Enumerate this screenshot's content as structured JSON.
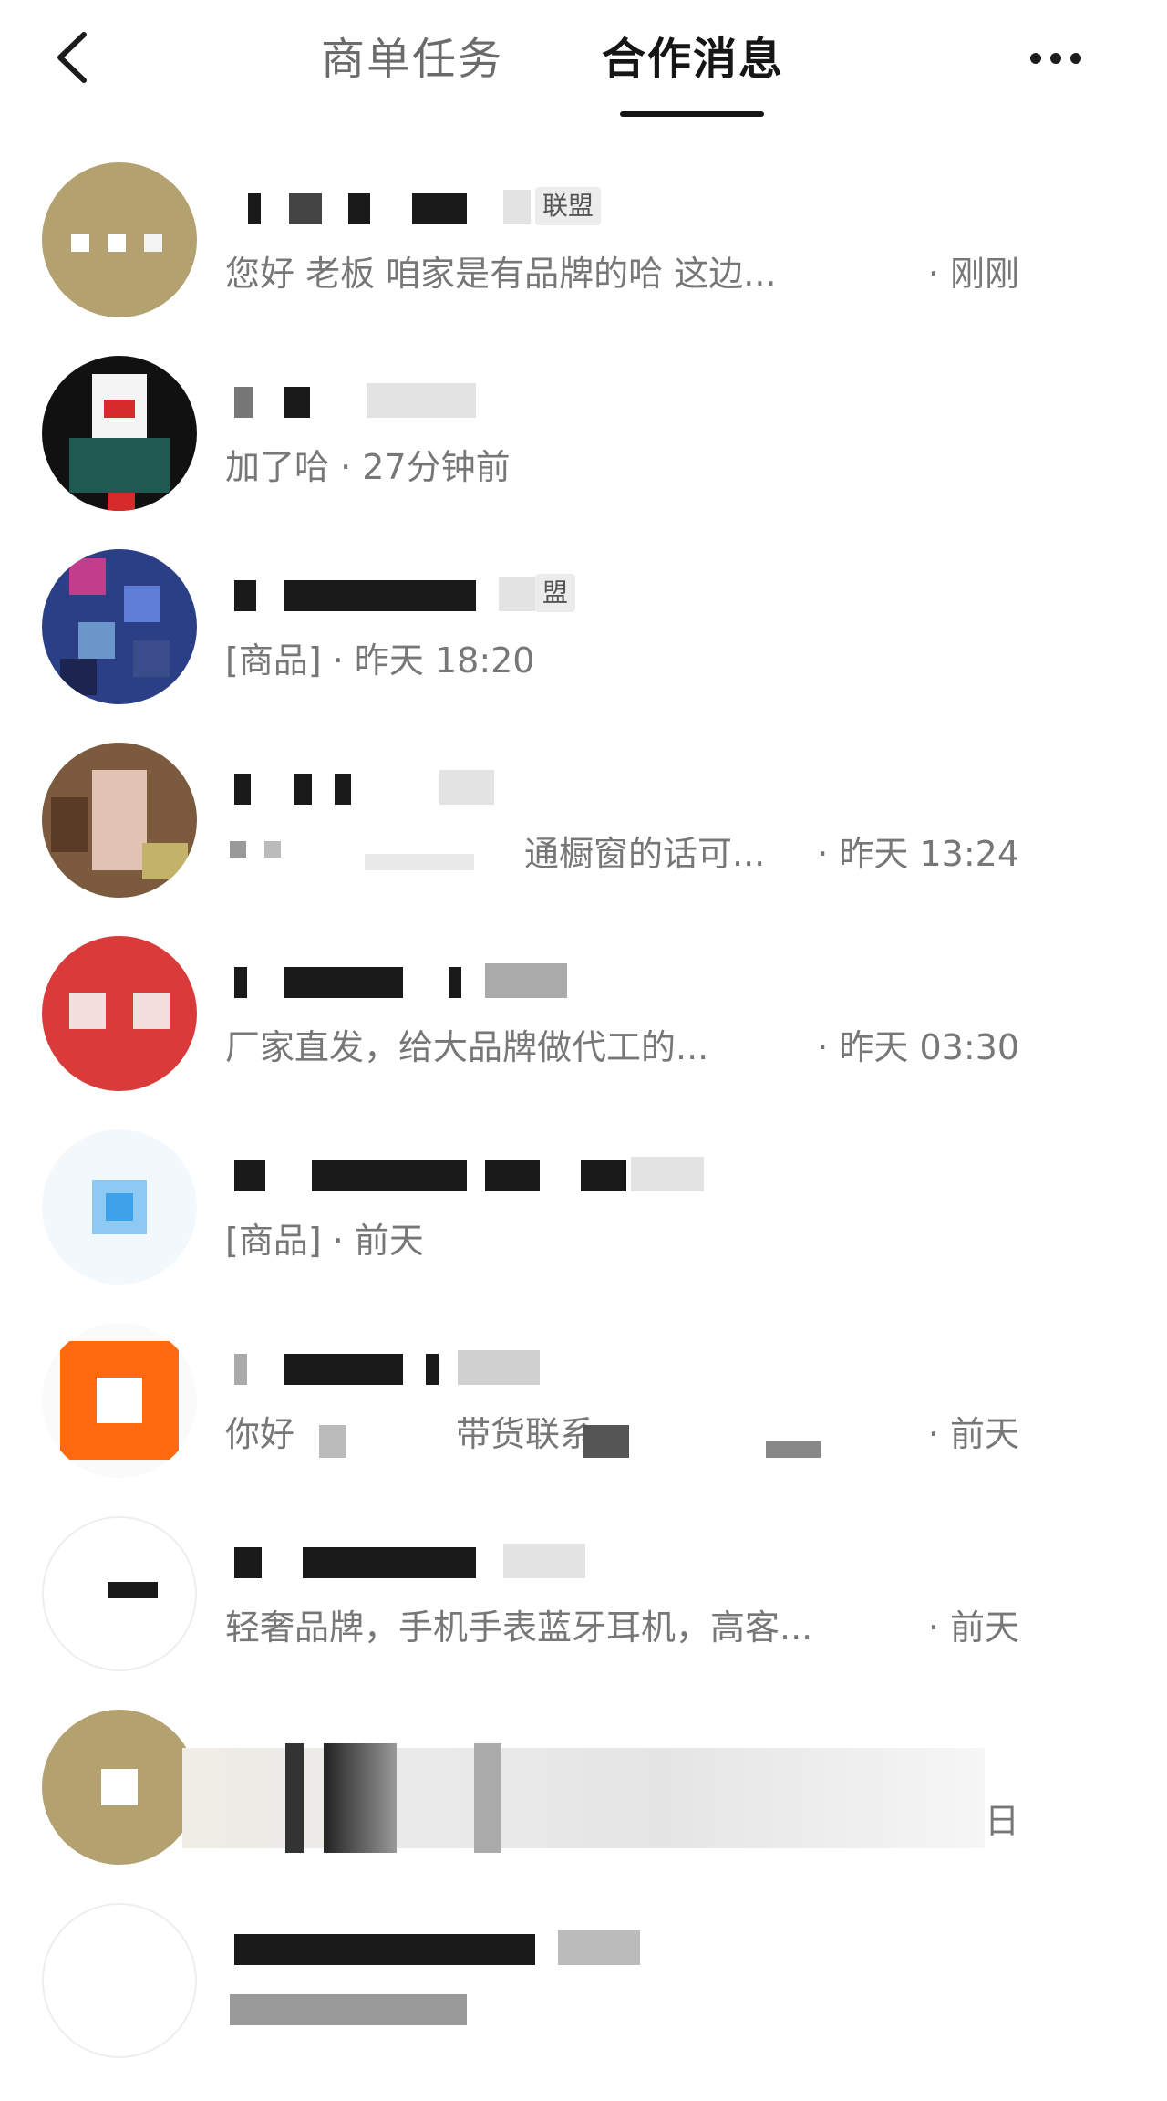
{
  "header": {
    "tabs": [
      {
        "label": "商单任务",
        "active": false
      },
      {
        "label": "合作消息",
        "active": true
      }
    ]
  },
  "messages": [
    {
      "tag": "联盟",
      "preview": "您好 老板  咱家是有品牌的哈   这边...",
      "time": "· 刚刚",
      "avatar_color": "#b3a270"
    },
    {
      "tag": "",
      "preview": "加了哈 · 27分钟前",
      "time": "",
      "avatar_color": "#1e1e1e"
    },
    {
      "tag": "盟",
      "preview": "[商品] · 昨天 18:20",
      "time": "",
      "avatar_color": "#4a5b9e"
    },
    {
      "tag": "",
      "preview": "通橱窗的话可...",
      "time": "· 昨天 13:24",
      "avatar_color": "#8a6a4c"
    },
    {
      "tag": "",
      "preview": "厂家直发，给大品牌做代工的...",
      "time": "· 昨天 03:30",
      "avatar_color": "#d93a3a"
    },
    {
      "tag": "",
      "preview": "[商品] · 前天",
      "time": "",
      "avatar_color": "#9fd2f5"
    },
    {
      "tag": "",
      "preview": "你好",
      "preview2": "带货联系",
      "time": "· 前天",
      "avatar_color": "#ff6a10"
    },
    {
      "tag": "",
      "preview": "轻奢品牌，手机手表蓝牙耳机，高客...",
      "time": "· 前天",
      "avatar_color": "#ffffff"
    },
    {
      "tag": "",
      "preview": "",
      "time": "日",
      "avatar_color": "#b3a270"
    },
    {
      "tag": "",
      "preview": "",
      "time": "",
      "avatar_color": "#ffffff"
    }
  ]
}
